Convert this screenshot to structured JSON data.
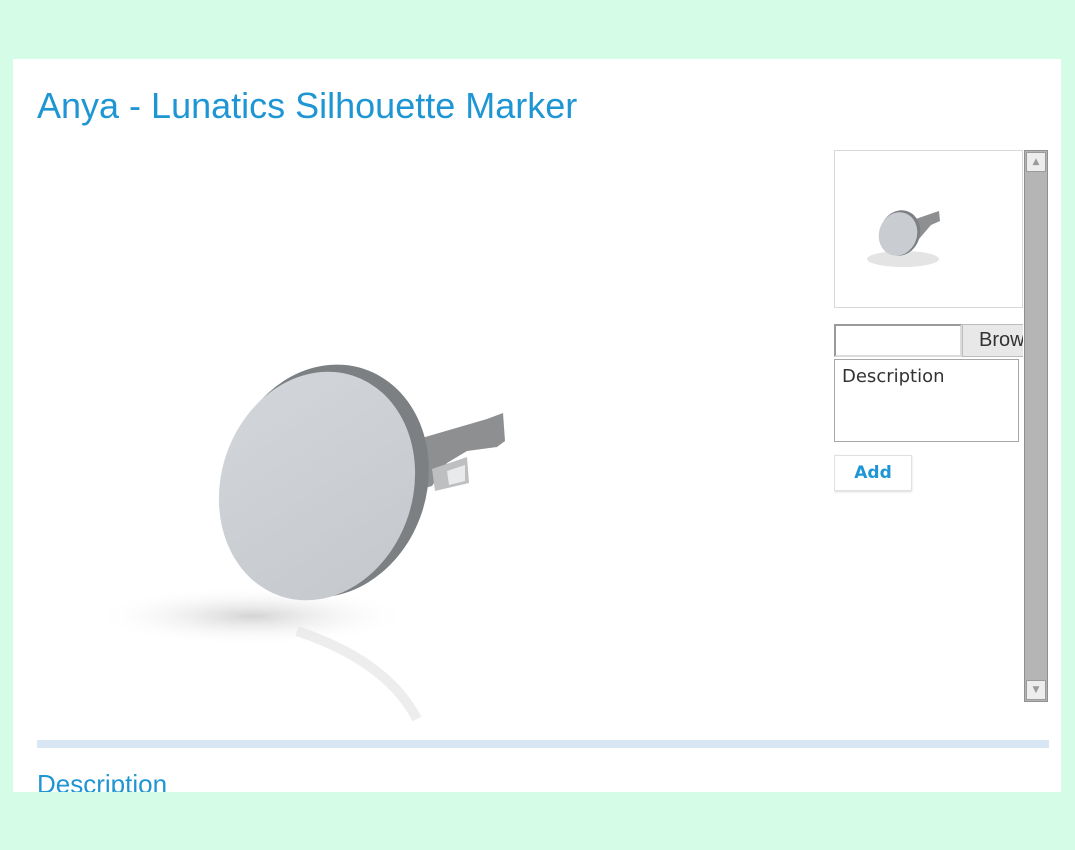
{
  "page": {
    "title": "Anya - Lunatics Silhouette Marker"
  },
  "viewer": {
    "image_subject": "3D render of round disc silhouette marker on a stand"
  },
  "sidebar": {
    "thumbnail_subject": "thumbnail of silhouette marker render",
    "file_input_value": "",
    "browse_label": "Brow",
    "description_placeholder": "Description",
    "add_label": "Add"
  },
  "sections": {
    "description_heading": "Description"
  },
  "colors": {
    "accent": "#1f96d4",
    "page_background": "#d4fce6",
    "divider": "#d9e7f4",
    "scrollbar": "#b5b5b5"
  },
  "icons": {
    "scroll_up": "triangle-up-icon",
    "scroll_down": "triangle-down-icon"
  }
}
